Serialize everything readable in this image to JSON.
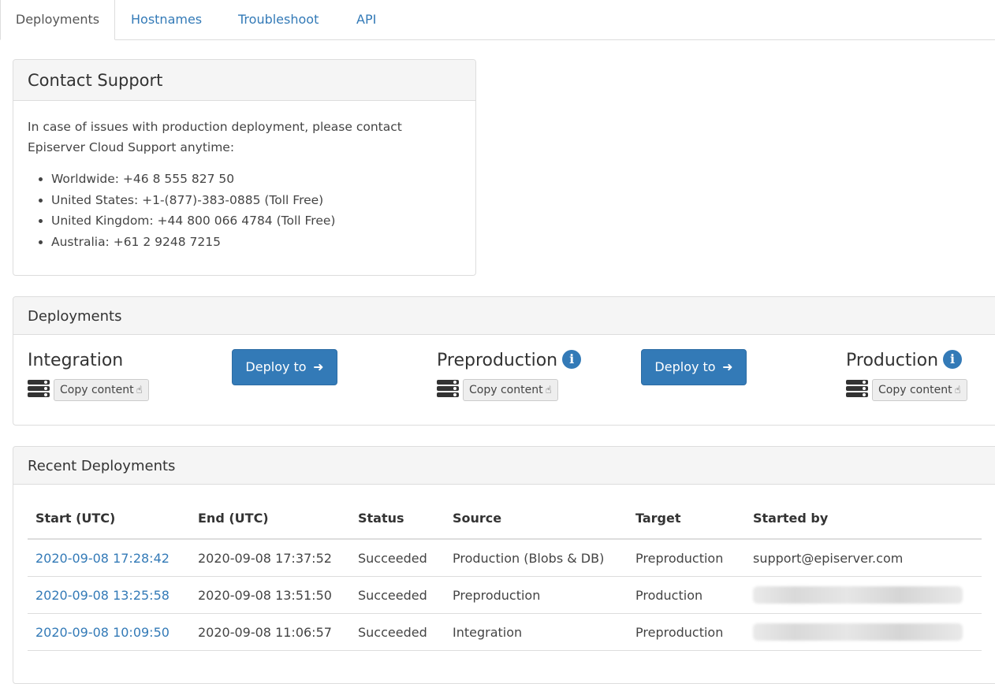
{
  "tabs": [
    {
      "label": "Deployments",
      "active": true
    },
    {
      "label": "Hostnames",
      "active": false
    },
    {
      "label": "Troubleshoot",
      "active": false
    },
    {
      "label": "API",
      "active": false
    }
  ],
  "contact_support": {
    "title": "Contact Support",
    "intro": "In case of issues with production deployment, please contact Episerver Cloud Support anytime:",
    "phones": [
      "Worldwide: +46 8 555 827 50",
      "United States: +1-(877)-383-0885 (Toll Free)",
      "United Kingdom: +44 800 066 4784 (Toll Free)",
      "Australia: +61 2 9248 7215"
    ]
  },
  "deployments": {
    "title": "Deployments",
    "environments": [
      {
        "name": "Integration",
        "info_icon": false,
        "copy_label": "Copy content"
      },
      {
        "name": "Preproduction",
        "info_icon": true,
        "copy_label": "Copy content"
      },
      {
        "name": "Production",
        "info_icon": true,
        "copy_label": "Copy content"
      }
    ],
    "deploy_button_label": "Deploy to",
    "icons": {
      "info": "info-icon",
      "server": "server-stack-icon",
      "copy": "hand-pointer-icon",
      "arrow": "arrow-right-icon"
    }
  },
  "recent": {
    "title": "Recent Deployments",
    "columns": [
      "Start (UTC)",
      "End (UTC)",
      "Status",
      "Source",
      "Target",
      "Started by"
    ],
    "rows": [
      {
        "start": "2020-09-08 17:28:42",
        "end": "2020-09-08 17:37:52",
        "status": "Succeeded",
        "source": "Production (Blobs & DB)",
        "target": "Preproduction",
        "started_by": "support@episerver.com"
      },
      {
        "start": "2020-09-08 13:25:58",
        "end": "2020-09-08 13:51:50",
        "status": "Succeeded",
        "source": "Preproduction",
        "target": "Production",
        "started_by": ""
      },
      {
        "start": "2020-09-08 10:09:50",
        "end": "2020-09-08 11:06:57",
        "status": "Succeeded",
        "source": "Integration",
        "target": "Preproduction",
        "started_by": ""
      }
    ]
  },
  "colors": {
    "link": "#337ab7",
    "primary_button": "#337ab7",
    "panel_heading_bg": "#f5f5f5",
    "border": "#dddddd"
  }
}
